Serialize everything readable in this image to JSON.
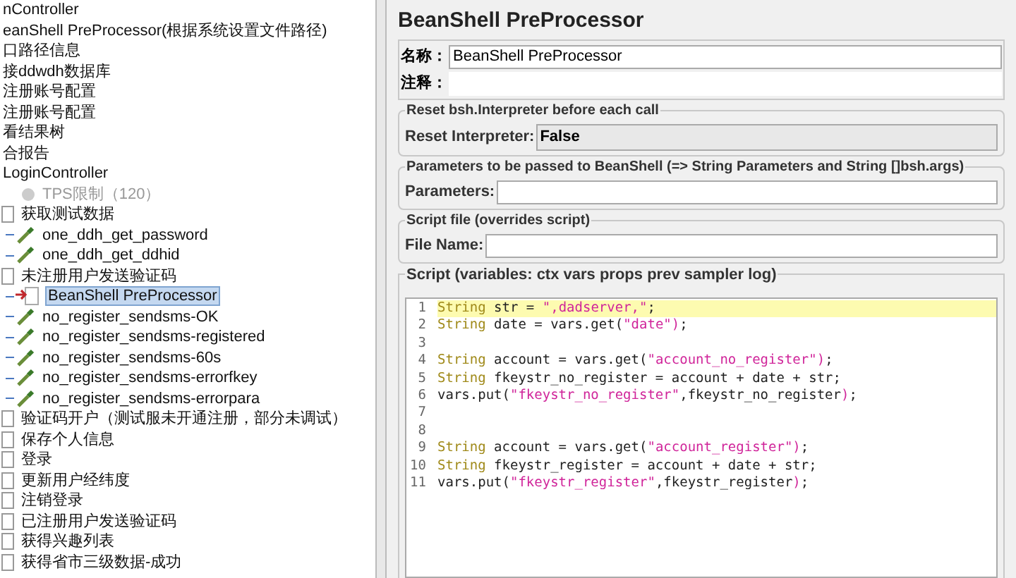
{
  "tree": [
    {
      "label": "nController",
      "selected": false,
      "disabled": false
    },
    {
      "label": "eanShell PreProcessor(根据系统设置文件路径)",
      "selected": false,
      "disabled": false
    },
    {
      "label": "口路径信息",
      "selected": false,
      "disabled": false
    },
    {
      "label": "接ddwdh数据库",
      "selected": false,
      "disabled": false
    },
    {
      "label": "注册账号配置",
      "selected": false,
      "disabled": false
    },
    {
      "label": "注册账号配置",
      "selected": false,
      "disabled": false
    },
    {
      "label": "看结果树",
      "selected": false,
      "disabled": false
    },
    {
      "label": "合报告",
      "selected": false,
      "disabled": false
    },
    {
      "label": "LoginController",
      "selected": false,
      "disabled": false,
      "children": [
        {
          "label": "TPS限制（120）",
          "kind": "timer",
          "selected": false,
          "disabled": true
        },
        {
          "label": "获取测试数据",
          "kind": "controller",
          "selected": false,
          "disabled": false,
          "children": [
            {
              "label": "one_ddh_get_password",
              "kind": "sampler",
              "selected": false,
              "disabled": false
            },
            {
              "label": "one_ddh_get_ddhid",
              "kind": "sampler",
              "selected": false,
              "disabled": false
            }
          ]
        },
        {
          "label": "未注册用户发送验证码",
          "kind": "controller",
          "selected": false,
          "disabled": false,
          "children": [
            {
              "label": "BeanShell PreProcessor",
              "kind": "preprocessor",
              "selected": true,
              "disabled": false
            },
            {
              "label": "no_register_sendsms-OK",
              "kind": "sampler",
              "selected": false,
              "disabled": false
            },
            {
              "label": "no_register_sendsms-registered",
              "kind": "sampler",
              "selected": false,
              "disabled": false
            },
            {
              "label": "no_register_sendsms-60s",
              "kind": "sampler",
              "selected": false,
              "disabled": false
            },
            {
              "label": "no_register_sendsms-errorfkey",
              "kind": "sampler",
              "selected": false,
              "disabled": false
            },
            {
              "label": "no_register_sendsms-errorpara",
              "kind": "sampler",
              "selected": false,
              "disabled": false
            }
          ]
        },
        {
          "label": "验证码开户（测试服未开通注册，部分未调试）",
          "kind": "controller",
          "selected": false,
          "disabled": false
        },
        {
          "label": "保存个人信息",
          "kind": "controller",
          "selected": false,
          "disabled": false
        },
        {
          "label": "登录",
          "kind": "controller",
          "selected": false,
          "disabled": false
        },
        {
          "label": "更新用户经纬度",
          "kind": "controller",
          "selected": false,
          "disabled": false
        },
        {
          "label": "注销登录",
          "kind": "controller",
          "selected": false,
          "disabled": false
        },
        {
          "label": "已注册用户发送验证码",
          "kind": "controller",
          "selected": false,
          "disabled": false
        },
        {
          "label": "获得兴趣列表",
          "kind": "controller",
          "selected": false,
          "disabled": false
        },
        {
          "label": "获得省市三级数据-成功",
          "kind": "controller",
          "selected": false,
          "disabled": false
        }
      ]
    }
  ],
  "panel": {
    "title": "BeanShell PreProcessor",
    "name_label": "名称：",
    "name_value": "BeanShell PreProcessor",
    "comment_label": "注释：",
    "reset_group": {
      "legend": "Reset bsh.Interpreter before each call",
      "label": "Reset Interpreter:",
      "value": "False"
    },
    "params_group": {
      "legend": "Parameters to be passed to BeanShell (=> String Parameters and String []bsh.args)",
      "label": "Parameters:"
    },
    "file_group": {
      "legend": "Script file (overrides script)",
      "label": "File Name:"
    },
    "script_group": {
      "legend": "Script (variables: ctx vars props prev sampler log)",
      "lines": [
        {
          "number": "1",
          "current": true,
          "tokens": [
            {
              "kind": "keyword",
              "text": "String"
            },
            {
              "kind": "plain",
              "text": " str = "
            },
            {
              "kind": "string",
              "text": "\",dadserver,\""
            },
            {
              "kind": "plain",
              "text": ";"
            }
          ]
        },
        {
          "number": "2",
          "current": false,
          "tokens": [
            {
              "kind": "keyword",
              "text": "String"
            },
            {
              "kind": "plain",
              "text": " date = vars.get("
            },
            {
              "kind": "string",
              "text": "\"date\""
            },
            {
              "kind": "paren",
              "text": ")"
            },
            {
              "kind": "plain",
              "text": ";"
            }
          ]
        },
        {
          "number": "3",
          "current": false
        },
        {
          "number": "4",
          "current": false,
          "tokens": [
            {
              "kind": "keyword",
              "text": "String"
            },
            {
              "kind": "plain",
              "text": " account = vars.get("
            },
            {
              "kind": "string",
              "text": "\"account_no_register\""
            },
            {
              "kind": "paren",
              "text": ")"
            },
            {
              "kind": "plain",
              "text": ";"
            }
          ]
        },
        {
          "number": "5",
          "current": false,
          "tokens": [
            {
              "kind": "keyword",
              "text": "String"
            },
            {
              "kind": "plain",
              "text": " fkeystr_no_register = account + date + str;"
            }
          ]
        },
        {
          "number": "6",
          "current": false,
          "tokens": [
            {
              "kind": "plain",
              "text": "vars.put("
            },
            {
              "kind": "string",
              "text": "\"fkeystr_no_register\""
            },
            {
              "kind": "plain",
              "text": ",fkeystr_no_register"
            },
            {
              "kind": "paren",
              "text": ")"
            },
            {
              "kind": "plain",
              "text": ";"
            }
          ]
        },
        {
          "number": "7",
          "current": false
        },
        {
          "number": "8",
          "current": false
        },
        {
          "number": "9",
          "current": false,
          "tokens": [
            {
              "kind": "keyword",
              "text": "String"
            },
            {
              "kind": "plain",
              "text": " account = vars.get("
            },
            {
              "kind": "string",
              "text": "\"account_register\""
            },
            {
              "kind": "paren",
              "text": ")"
            },
            {
              "kind": "plain",
              "text": ";"
            }
          ]
        },
        {
          "number": "10",
          "current": false,
          "tokens": [
            {
              "kind": "keyword",
              "text": "String"
            },
            {
              "kind": "plain",
              "text": " fkeystr_register = account + date + str;"
            }
          ]
        },
        {
          "number": "11",
          "current": false,
          "tokens": [
            {
              "kind": "plain",
              "text": "vars.put("
            },
            {
              "kind": "string",
              "text": "\"fkeystr_register\""
            },
            {
              "kind": "plain",
              "text": ",fkeystr_register"
            },
            {
              "kind": "paren",
              "text": ")"
            },
            {
              "kind": "plain",
              "text": ";"
            }
          ]
        }
      ]
    }
  }
}
